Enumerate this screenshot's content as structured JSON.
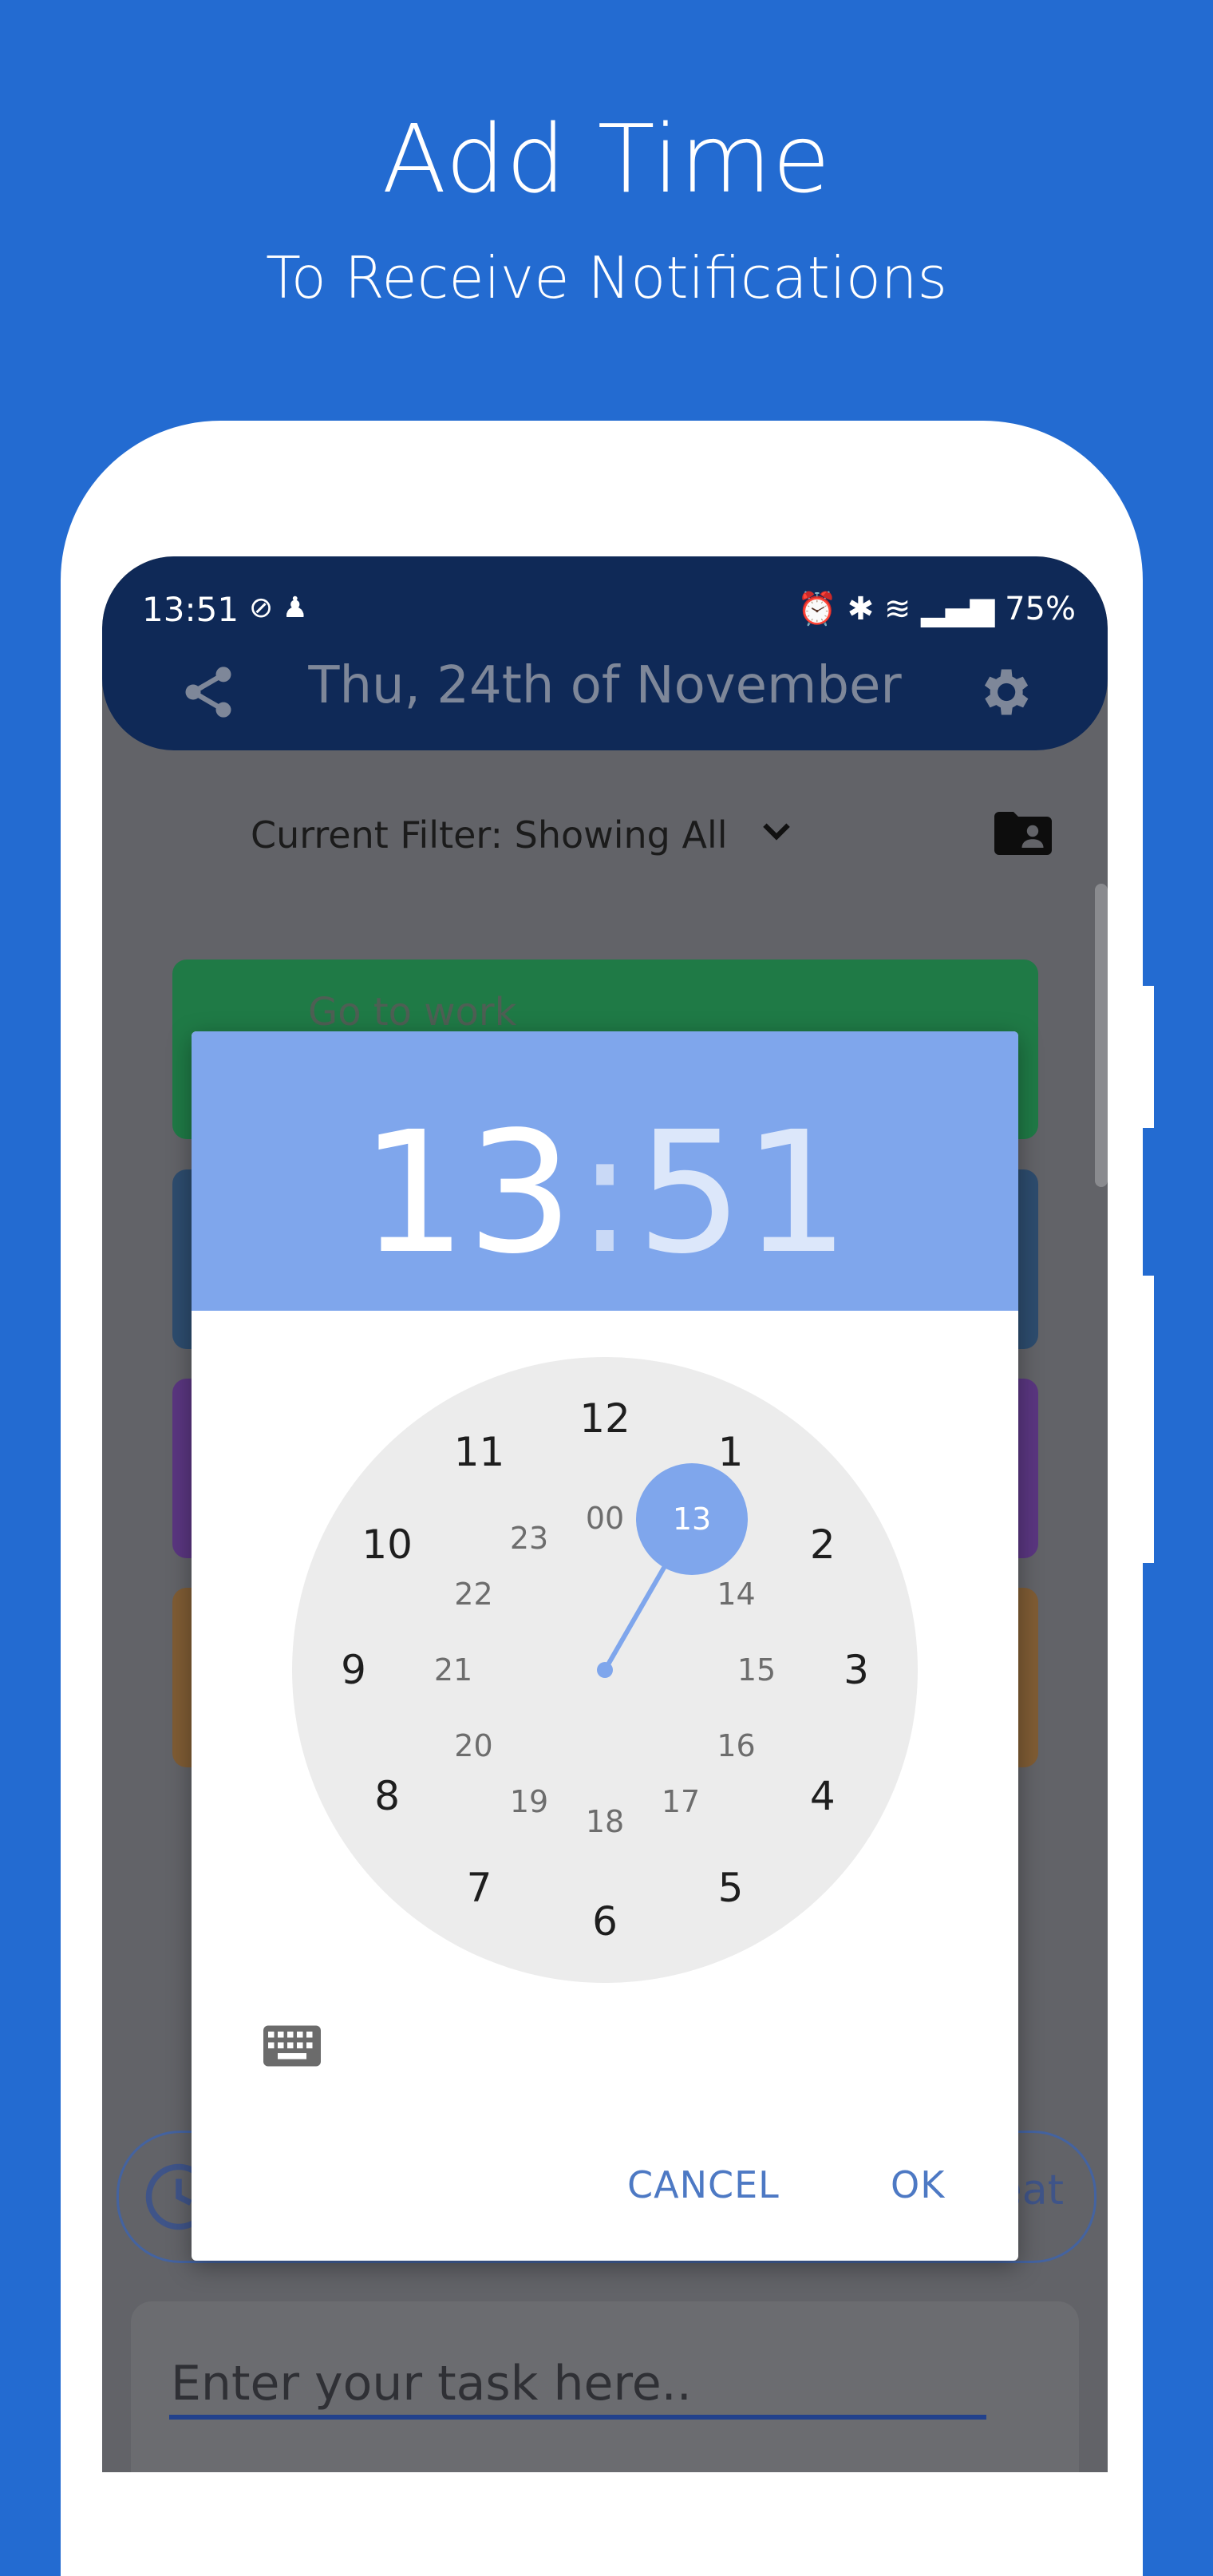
{
  "promo": {
    "title": "Add Time",
    "subtitle": "To Receive Notifications"
  },
  "status_bar": {
    "time": "13:51",
    "right_text": "75%"
  },
  "app_bar": {
    "date_title": "Thu, 24th of November"
  },
  "filter": {
    "label": "Current Filter: Showing All"
  },
  "tasks": [
    {
      "label": "Go to work",
      "color": "#1f7a46"
    },
    {
      "label": "",
      "color": "#2d4c6e"
    },
    {
      "label": "",
      "color": "#5a3680"
    },
    {
      "label": "",
      "color": "#7f5c34"
    }
  ],
  "bottom_pill": {
    "text": "eat"
  },
  "task_input": {
    "placeholder": "Enter your task here.."
  },
  "dialog": {
    "hours": "13",
    "colon": ":",
    "minutes": "51",
    "outer_hours": [
      "12",
      "1",
      "2",
      "3",
      "4",
      "5",
      "6",
      "7",
      "8",
      "9",
      "10",
      "11"
    ],
    "inner_hours": [
      "00",
      "13",
      "14",
      "15",
      "16",
      "17",
      "18",
      "19",
      "20",
      "21",
      "22",
      "23"
    ],
    "selected_hour": "13",
    "cancel_label": "CANCEL",
    "ok_label": "OK"
  },
  "colors": {
    "background": "#236bd1",
    "app_bar": "#0f2957",
    "dialog_accent": "#7fa6ec",
    "button_text": "#4d79c4"
  }
}
